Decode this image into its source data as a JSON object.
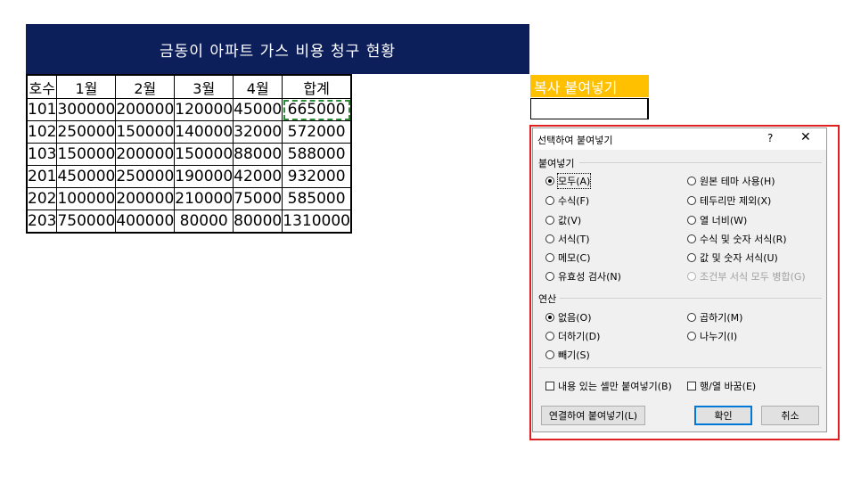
{
  "sheet": {
    "title": "금동이 아파트 가스 비용 청구 현황",
    "headers": [
      "호수",
      "1월",
      "2월",
      "3월",
      "4월",
      "합계"
    ],
    "rows": [
      [
        "101",
        "300000",
        "200000",
        "120000",
        "45000",
        "665000"
      ],
      [
        "102",
        "250000",
        "150000",
        "140000",
        "32000",
        "572000"
      ],
      [
        "103",
        "150000",
        "200000",
        "150000",
        "88000",
        "588000"
      ],
      [
        "201",
        "450000",
        "250000",
        "190000",
        "42000",
        "932000"
      ],
      [
        "202",
        "100000",
        "200000",
        "210000",
        "75000",
        "585000"
      ],
      [
        "203",
        "750000",
        "400000",
        "80000",
        "80000",
        "1310000"
      ]
    ],
    "copy_label": "복사 붙여넣기",
    "colors": {
      "title_bg": "#0d1f5a",
      "copy_label_bg": "#ffc000",
      "copy_marquee": "#2e8b3a"
    }
  },
  "dialog": {
    "title": "선택하여 붙여넣기",
    "help": "?",
    "close": "✕",
    "paste_section": "붙여넣기",
    "paste_options_left": [
      "모두(A)",
      "수식(F)",
      "값(V)",
      "서식(T)",
      "메모(C)",
      "유효성 검사(N)"
    ],
    "paste_options_right": [
      "원본 테마 사용(H)",
      "테두리만 제외(X)",
      "열 너비(W)",
      "수식 및 숫자 서식(R)",
      "값 및 숫자 서식(U)",
      "조건부 서식 모두 병합(G)"
    ],
    "operation_section": "연산",
    "operation_left": [
      "없음(O)",
      "더하기(D)",
      "빼기(S)"
    ],
    "operation_right": [
      "곱하기(M)",
      "나누기(I)"
    ],
    "skip_blanks": "내용 있는 셀만 붙여넣기(B)",
    "transpose": "행/열 바꿈(E)",
    "paste_link_button": "연결하여 붙여넣기(L)",
    "ok_button": "확인",
    "cancel_button": "취소",
    "selected_paste": "모두(A)",
    "selected_operation": "없음(O)"
  }
}
